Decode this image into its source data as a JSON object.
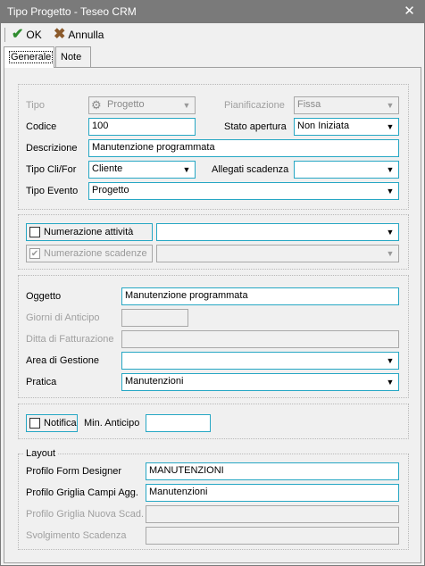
{
  "window": {
    "title": "Tipo Progetto - Teseo CRM",
    "close_glyph": "✕"
  },
  "toolbar": {
    "ok_label": "OK",
    "ok_icon": "check-icon",
    "ok_glyph": "✔",
    "cancel_label": "Annulla",
    "cancel_icon": "x-icon",
    "cancel_glyph": "✖"
  },
  "tabs": [
    {
      "label": "Generale",
      "active": true
    },
    {
      "label": "Note",
      "active": false
    }
  ],
  "dropdown_arrow": "▼",
  "general": {
    "tipo": {
      "label": "Tipo",
      "value": "Progetto",
      "icon": "project-tool-icon",
      "icon_glyph": "⚙"
    },
    "pianificazione": {
      "label": "Pianificazione",
      "value": "Fissa"
    },
    "codice": {
      "label": "Codice",
      "value": "100"
    },
    "stato_apertura": {
      "label": "Stato apertura",
      "value": "Non Iniziata"
    },
    "descrizione": {
      "label": "Descrizione",
      "value": "Manutenzione programmata"
    },
    "tipo_cli_for": {
      "label": "Tipo Cli/For",
      "value": "Cliente"
    },
    "allegati_scadenza": {
      "label": "Allegati scadenza",
      "value": ""
    },
    "tipo_evento": {
      "label": "Tipo Evento",
      "value": "Progetto"
    }
  },
  "numerazione": {
    "attivita": {
      "label": "Numerazione attività",
      "checked": false,
      "value": ""
    },
    "scadenze": {
      "label": "Numerazione scadenze",
      "checked": true,
      "check_glyph": "✔",
      "value": ""
    }
  },
  "details": {
    "oggetto": {
      "label": "Oggetto",
      "value": "Manutenzione programmata"
    },
    "giorni_anticipo": {
      "label": "Giorni di Anticipo",
      "value": ""
    },
    "ditta_fatturazione": {
      "label": "Ditta di Fatturazione",
      "value": ""
    },
    "area_gestione": {
      "label": "Area di Gestione",
      "value": ""
    },
    "pratica": {
      "label": "Pratica",
      "value": "Manutenzioni"
    }
  },
  "notifica": {
    "label": "Notifica",
    "checked": false,
    "min_anticipo_label": "Min. Anticipo",
    "min_anticipo_value": ""
  },
  "layout": {
    "legend": "Layout",
    "profilo_form_designer": {
      "label": "Profilo Form Designer",
      "value": "MANUTENZIONI"
    },
    "profilo_griglia_campi": {
      "label": "Profilo Griglia Campi Agg.",
      "value": "Manutenzioni"
    },
    "profilo_griglia_nuova": {
      "label": "Profilo Griglia Nuova Scad.",
      "value": ""
    },
    "svolgimento_scadenza": {
      "label": "Svolgimento Scadenza",
      "value": ""
    }
  }
}
